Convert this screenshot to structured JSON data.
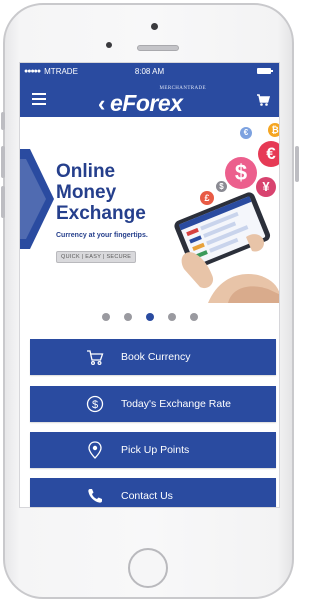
{
  "status_bar": {
    "signal_dots": "●●●●●",
    "carrier": "MTRADE",
    "time": "8:08 AM",
    "battery_icon": "battery-full-icon"
  },
  "header": {
    "menu_icon": "hamburger-icon",
    "logo_chevron": "‹",
    "logo_word": "eForex",
    "logo_subtitle": "MERCHANTRADE",
    "cart_icon": "cart-icon",
    "brand_color": "#2a4ba0"
  },
  "banner": {
    "title_lines": [
      "Online",
      "Money",
      "Exchange"
    ],
    "subtitle": "Currency at your fingertips.",
    "tag": "QUICK | EASY | SECURE",
    "currency_symbols": [
      "₿",
      "€",
      "$",
      "¥",
      "£",
      "$",
      "€"
    ]
  },
  "carousel": {
    "dot_count": 5,
    "active_index": 2
  },
  "menu": [
    {
      "label": "Book Currency",
      "icon": "cart-icon"
    },
    {
      "label": "Today's Exchange Rate",
      "icon": "dollar-coin-icon"
    },
    {
      "label": "Pick Up Points",
      "icon": "location-pin-icon"
    },
    {
      "label": "Contact Us",
      "icon": "phone-icon"
    }
  ]
}
